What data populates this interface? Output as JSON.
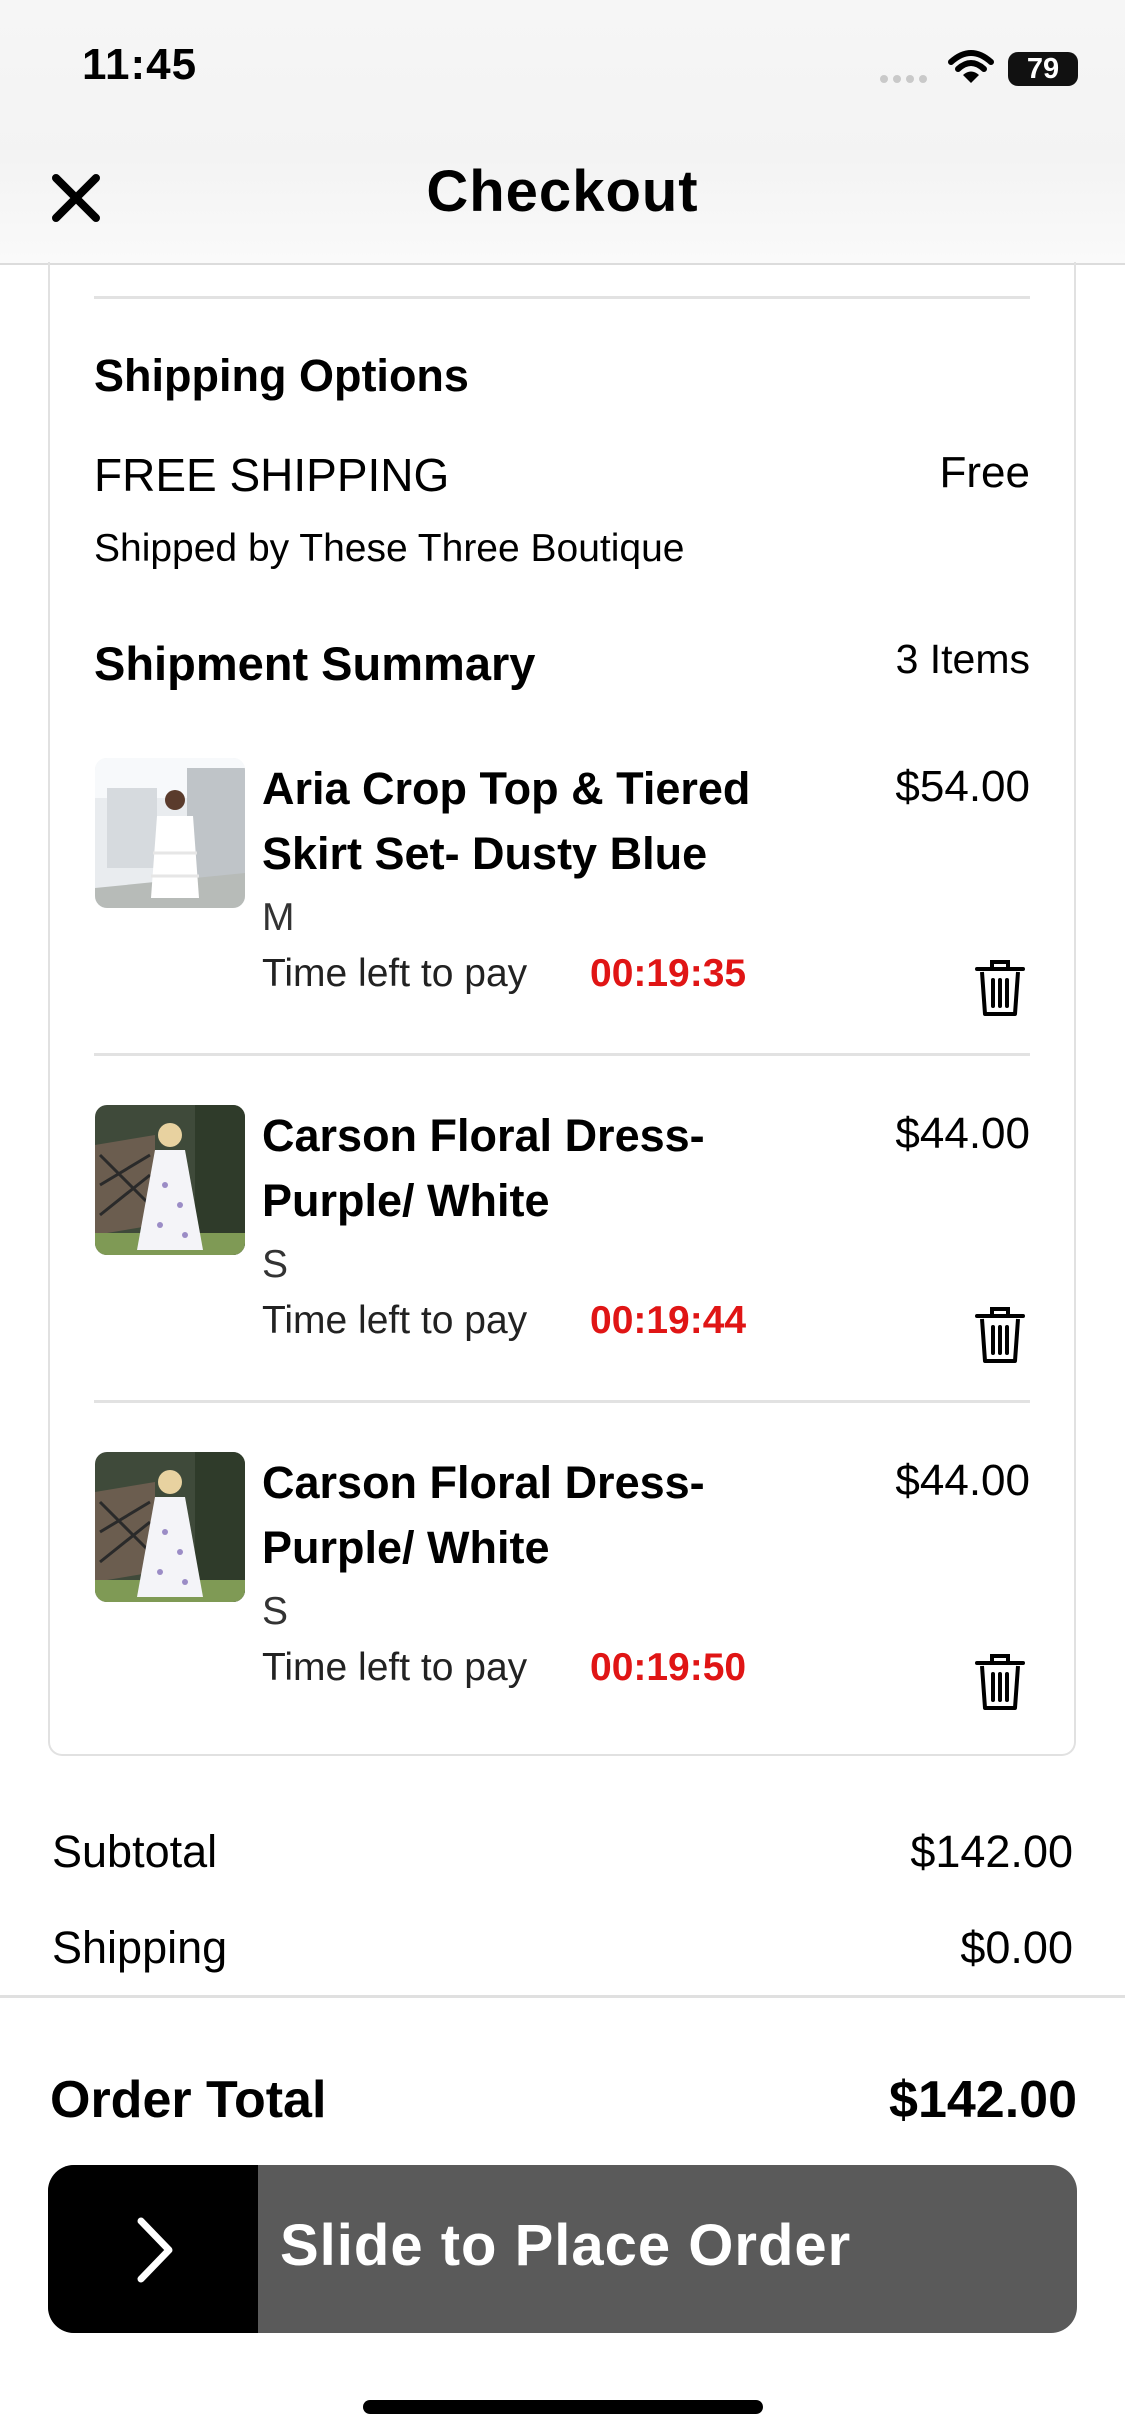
{
  "status_bar": {
    "time": "11:45",
    "battery": "79"
  },
  "header": {
    "title": "Checkout"
  },
  "shipping": {
    "section_title": "Shipping Options",
    "option_name": "FREE SHIPPING",
    "option_price": "Free",
    "shipped_by": "Shipped by These Three Boutique"
  },
  "summary": {
    "title": "Shipment Summary",
    "count": "3 Items",
    "time_label": "Time left to pay",
    "items": [
      {
        "name": "Aria Crop Top & Tiered Skirt Set- Dusty Blue",
        "size": "M",
        "price": "$54.00",
        "timer": "00:19:35"
      },
      {
        "name": "Carson Floral Dress- Purple/ White",
        "size": "S",
        "price": "$44.00",
        "timer": "00:19:44"
      },
      {
        "name": "Carson Floral Dress- Purple/ White",
        "size": "S",
        "price": "$44.00",
        "timer": "00:19:50"
      }
    ]
  },
  "totals": {
    "subtotal_label": "Subtotal",
    "subtotal": "$142.00",
    "shipping_label": "Shipping",
    "shipping": "$0.00",
    "order_total_label": "Order Total",
    "order_total": "$142.00"
  },
  "slider": {
    "label": "Slide to Place Order"
  },
  "colors": {
    "timer": "#e01515",
    "slider_bg": "#5a5a5a",
    "slider_knob": "#000000"
  },
  "icons": [
    "close-icon",
    "trash-icon",
    "chevron-right-icon",
    "wifi-icon"
  ]
}
